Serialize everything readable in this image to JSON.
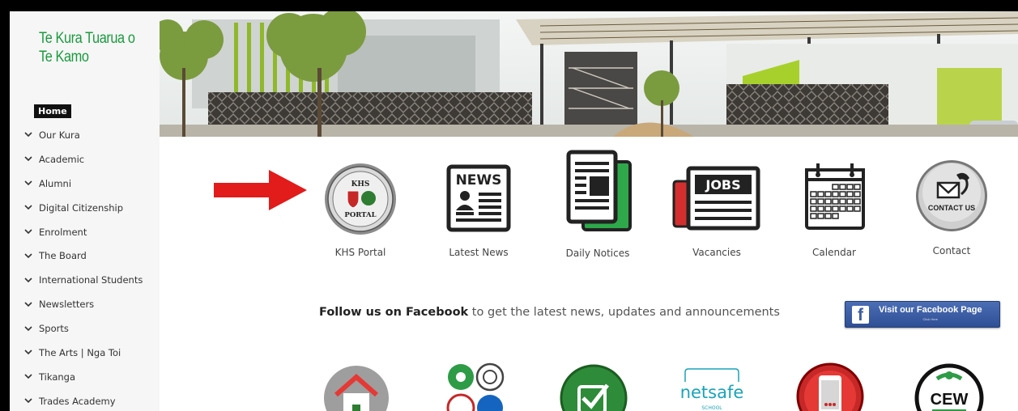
{
  "site": {
    "title": "Te Kura Tuarua o Te Kamo"
  },
  "sidebar": {
    "home_label": "Home",
    "items": [
      {
        "label": "Our Kura"
      },
      {
        "label": "Academic"
      },
      {
        "label": "Alumni"
      },
      {
        "label": "Digital Citizenship"
      },
      {
        "label": "Enrolment"
      },
      {
        "label": "The Board"
      },
      {
        "label": "International Students"
      },
      {
        "label": "Newsletters"
      },
      {
        "label": "Sports"
      },
      {
        "label": "The Arts | Nga Toi"
      },
      {
        "label": "Tikanga"
      },
      {
        "label": "Trades Academy"
      }
    ]
  },
  "quick_links": [
    {
      "label": "KHS Portal",
      "icon": "khs-portal-icon",
      "badge_top": "KHS",
      "badge_bottom": "PORTAL"
    },
    {
      "label": "Latest News",
      "icon": "news-icon",
      "badge": "NEWS"
    },
    {
      "label": "Daily Notices",
      "icon": "notices-icon"
    },
    {
      "label": "Vacancies",
      "icon": "jobs-icon",
      "badge": "JOBS"
    },
    {
      "label": "Calendar",
      "icon": "calendar-icon"
    },
    {
      "label": "Contact",
      "icon": "contact-icon",
      "badge": "CONTACT US"
    }
  ],
  "facebook": {
    "follow_bold": "Follow us on Facebook",
    "follow_rest": " to get the latest news, updates and announcements",
    "button_label": "Visit our Facebook Page",
    "button_sub": "Click Here",
    "button_letter": "f"
  },
  "bottom_icons": [
    {
      "icon": "home-icon"
    },
    {
      "icon": "koru-icon"
    },
    {
      "icon": "checkmark-icon"
    },
    {
      "icon": "netsafe-icon",
      "text": "netsafe",
      "sub": "SCHOOL"
    },
    {
      "icon": "app-icon"
    },
    {
      "icon": "cew-icon",
      "text": "CEW"
    }
  ],
  "colors": {
    "brand_green": "#1a9a3e",
    "arrow_red": "#e21b1b",
    "facebook_blue": "#3a5ca3"
  }
}
